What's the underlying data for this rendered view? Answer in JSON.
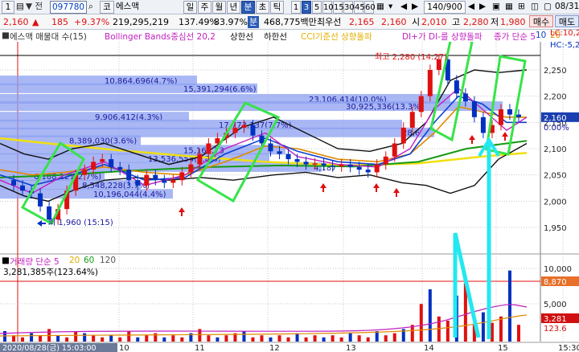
{
  "toolbar": {
    "count_cell": "1",
    "code": "097780",
    "market_tag": "코",
    "stock_name": "에스맥",
    "period_buttons": [
      "일",
      "주",
      "월",
      "년",
      "분",
      "초",
      "틱"
    ],
    "interval_buttons": [
      "1",
      "3",
      "5",
      "10",
      "15",
      "30",
      "45",
      "60"
    ],
    "active_interval": "3",
    "page": "140/900",
    "date": "08/31"
  },
  "quote": {
    "price": "2,160",
    "arrow": "▲",
    "change": "185",
    "change_pct": "+9.37%",
    "volume": "219,295,219",
    "vol_ratio": "137.49%",
    "strength": "83.97%",
    "amount_tag": "분",
    "amount": "468,775백만",
    "best_ask_label": "최우선",
    "best_ask": "2,165",
    "best_bid": "2,160",
    "open_label": "시",
    "open": "2,010",
    "high_label": "고",
    "high": "2,280",
    "low_label": "저",
    "low": "1,980",
    "sell_button": "매수",
    "buy_button": "매도"
  },
  "legend": {
    "items": [
      "에스맥 매물대 수(15)",
      "Bollinger Bands중심선 20,2",
      "상한선",
      "하한선",
      "CCI기준선 상향돌파",
      "DI+가 DI-를 상향돌파",
      "종가 단순 5",
      "10",
      "20"
    ],
    "right": [
      "LC:10,2",
      "HC:-5,2"
    ]
  },
  "volume_legend": [
    "거래량 단순 5",
    "20",
    "60",
    "120"
  ],
  "volume_label": "3,281,385주(123.64%)",
  "annotations": {
    "high": "최고 2,280 (14:27)",
    "low": "최 1,960 (15:15)"
  },
  "current_price_tag": "2,160",
  "current_pct_tag": "0.00%",
  "volume_tags": [
    "8,870",
    "3,281",
    "123.6"
  ],
  "colors": {
    "up": "#e01010",
    "down": "#0030c0",
    "green_box": "#37e34a",
    "cyan_mark": "#23e8f0",
    "ma5": "#c020c0",
    "ma10": "#1040d0",
    "ma20": "#e08a00",
    "bb": "#111111",
    "ma_long": "#169a16",
    "yellow": "#f0e010"
  },
  "chart_data": {
    "type": "candlestick",
    "y_axis_ticks": [
      "2,250",
      "2,200",
      "2,150",
      "2,100",
      "2,050",
      "2,000",
      "1,950"
    ],
    "volume_axis_ticks": [
      "10,000",
      "5,000"
    ],
    "x_axis_labels": [
      "2020/08/28(금) 15:03:00",
      "10",
      "11",
      "12",
      "13",
      "14",
      "15",
      "15:30"
    ],
    "ylim": [
      1900,
      2300
    ],
    "volume_profile": [
      {
        "label": "10,864,696(4.7%)",
        "price": 2230
      },
      {
        "label": "15,391,294(6.6%)",
        "price": 2215
      },
      {
        "label": "23,106,414(10.0%)",
        "price": 2195
      },
      {
        "label": "30,925,336(13.3%)",
        "price": 2181
      },
      {
        "label": "9,906,412(4.3%)",
        "price": 2161
      },
      {
        "label": "17,773,137(7.7%)",
        "price": 2146
      },
      {
        "label": "28,6",
        "price": 2131
      },
      {
        "label": "8,389,030(3.6%)",
        "price": 2116
      },
      {
        "label": "15,168,73",
        "price": 2098
      },
      {
        "label": "13,536,554(5.8%)",
        "price": 2082
      },
      {
        "label": "4,187",
        "price": 2065
      },
      {
        "label": "6,188,121(2.7%)",
        "price": 2048
      },
      {
        "label": "8,548,228(3.7%)",
        "price": 2031
      },
      {
        "label": "10,196,044(4.4%)",
        "price": 2014
      }
    ]
  }
}
